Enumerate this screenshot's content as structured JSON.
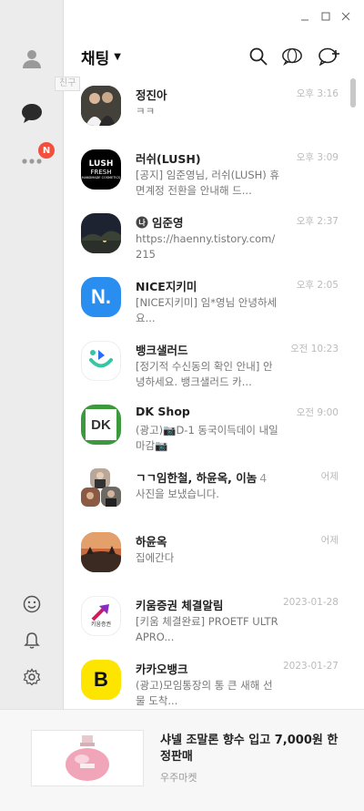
{
  "sidebar": {
    "badge": "N",
    "tooltip": "친구"
  },
  "header": {
    "title": "채팅"
  },
  "chats": [
    {
      "name": "정진아",
      "count": "",
      "preview": "ㅋㅋ",
      "time": "오후 3:16"
    },
    {
      "name": "러쉬(LUSH)",
      "count": "",
      "preview": "[공지] 임준영님, 러쉬(LUSH) 휴면계정 전환을 안내해 드...",
      "time": "오후 3:09"
    },
    {
      "name": "임준영",
      "count": "",
      "preview": "https://haenny.tistory.com/215",
      "time": "오후 2:37"
    },
    {
      "name": "NICE지키미",
      "count": "",
      "preview": "[NICE지키미] 임*영님 안녕하세요...",
      "time": "오후 2:05"
    },
    {
      "name": "뱅크샐러드",
      "count": "",
      "preview": "[정기적 수신동의 확인 안내] 안녕하세요. 뱅크샐러드 카...",
      "time": "오전 10:23"
    },
    {
      "name": "DK Shop",
      "count": "",
      "preview": "(광고)📷D-1 동국이득데이 내일마감📷",
      "time": "오전 9:00"
    },
    {
      "name": "ㄱㄱ임한철, 하윤옥, 이놈",
      "count": "4",
      "preview": "사진을 보냈습니다.",
      "time": "어제"
    },
    {
      "name": "하윤옥",
      "count": "",
      "preview": "집에간다",
      "time": "어제"
    },
    {
      "name": "키움증권 체결알림",
      "count": "",
      "preview": "[키움 체결완료] PROETF ULTRAPRO...",
      "time": "2023-01-28"
    },
    {
      "name": "카카오뱅크",
      "count": "",
      "preview": "(광고)모임통장의 통 큰 새해 선물 도착...",
      "time": "2023-01-27"
    }
  ],
  "avatars": {
    "lush_text": "LUSH",
    "lush_sub1": "FRESH",
    "lush_sub2": "HANDMADE COSMETICS",
    "dk_text": "DK",
    "kiwoom_text": "키움증권",
    "kakaobank_text": "B",
    "nice_text": "N."
  },
  "ad": {
    "title": "샤넬 조말론 향수 입고 7,000원 한정판매",
    "subtitle": "우주마켓"
  },
  "colors": {
    "sidebar_bg": "#ececec",
    "badge": "#f0503c",
    "kakao_yellow": "#fee500",
    "nice_blue": "#2a8ef0",
    "dk_green": "#3c9a3c"
  }
}
